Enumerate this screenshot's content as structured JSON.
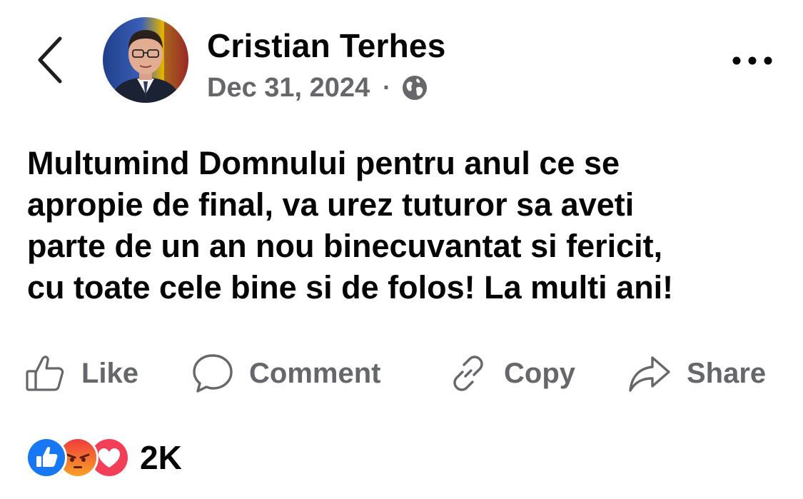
{
  "post": {
    "author": "Cristian Terhes",
    "date": "Dec 31, 2024",
    "separator": "·",
    "privacy_icon": "globe-icon",
    "text": "Multumind Domnului pentru anul ce se\napropie de final, va urez tuturor sa aveti\nparte de un an nou binecuvantat si fericit,\ncu toate cele bine si de folos! La multi ani!"
  },
  "header": {
    "back_icon": "chevron-left-icon",
    "more_icon": "more-horizontal-icon"
  },
  "actions": {
    "like_label": "Like",
    "comment_label": "Comment",
    "copy_label": "Copy",
    "share_label": "Share"
  },
  "reactions": {
    "types": [
      "like",
      "angry",
      "love"
    ],
    "count": "2K"
  },
  "colors": {
    "text": "#050505",
    "secondary_text": "#65676b",
    "like_blue": "#1877f2",
    "love_red": "#f33e58",
    "angry_orange": "#e9710f"
  }
}
